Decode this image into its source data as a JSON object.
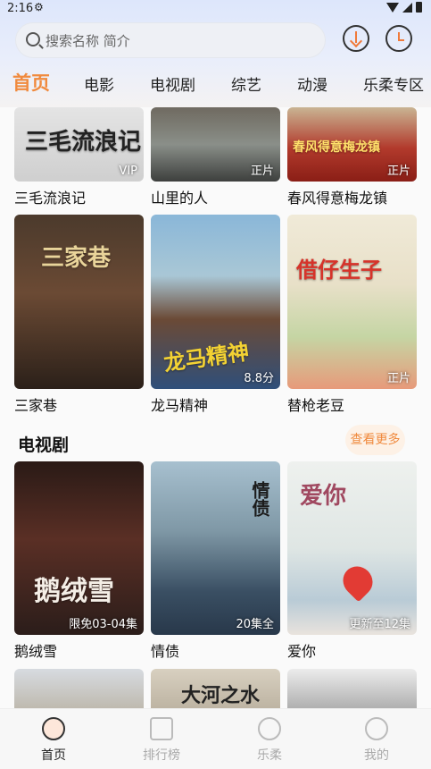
{
  "status": {
    "time": "2:16"
  },
  "search": {
    "placeholder": "搜索名称 简介"
  },
  "tabs": [
    "首页",
    "电影",
    "电视剧",
    "综艺",
    "动漫",
    "乐柔专区"
  ],
  "movies_row1": [
    {
      "title": "三毛流浪记",
      "badge": "VIP"
    },
    {
      "title": "山里的人",
      "badge": "正片"
    },
    {
      "title": "春风得意梅龙镇",
      "badge": "正片"
    }
  ],
  "movies_row2": [
    {
      "title": "三家巷",
      "badge": ""
    },
    {
      "title": "龙马精神",
      "badge": "8.8分"
    },
    {
      "title": "替枪老豆",
      "badge": "正片"
    }
  ],
  "tv_section": {
    "title": "电视剧",
    "more": "查看更多"
  },
  "tv_row1": [
    {
      "title": "鹅绒雪",
      "badge": "限免03-04集"
    },
    {
      "title": "情债",
      "badge": "20集全"
    },
    {
      "title": "爱你",
      "badge": "更新至12集"
    }
  ],
  "poster_text": {
    "p1": "三毛流浪记",
    "p3": "春风得意梅龙镇",
    "p4": "三家巷",
    "p5": "龙马精神",
    "p6": "借仔生子",
    "p7": "鹅绒雪",
    "p8": "情债",
    "p9": "爱你",
    "p11": "大河之水"
  },
  "bottom_nav": [
    {
      "label": "首页",
      "icon": "home-icon"
    },
    {
      "label": "排行榜",
      "icon": "rank-icon"
    },
    {
      "label": "乐柔",
      "icon": "lerou-icon"
    },
    {
      "label": "我的",
      "icon": "profile-icon"
    }
  ],
  "colors": {
    "accent": "#f08a3e"
  }
}
